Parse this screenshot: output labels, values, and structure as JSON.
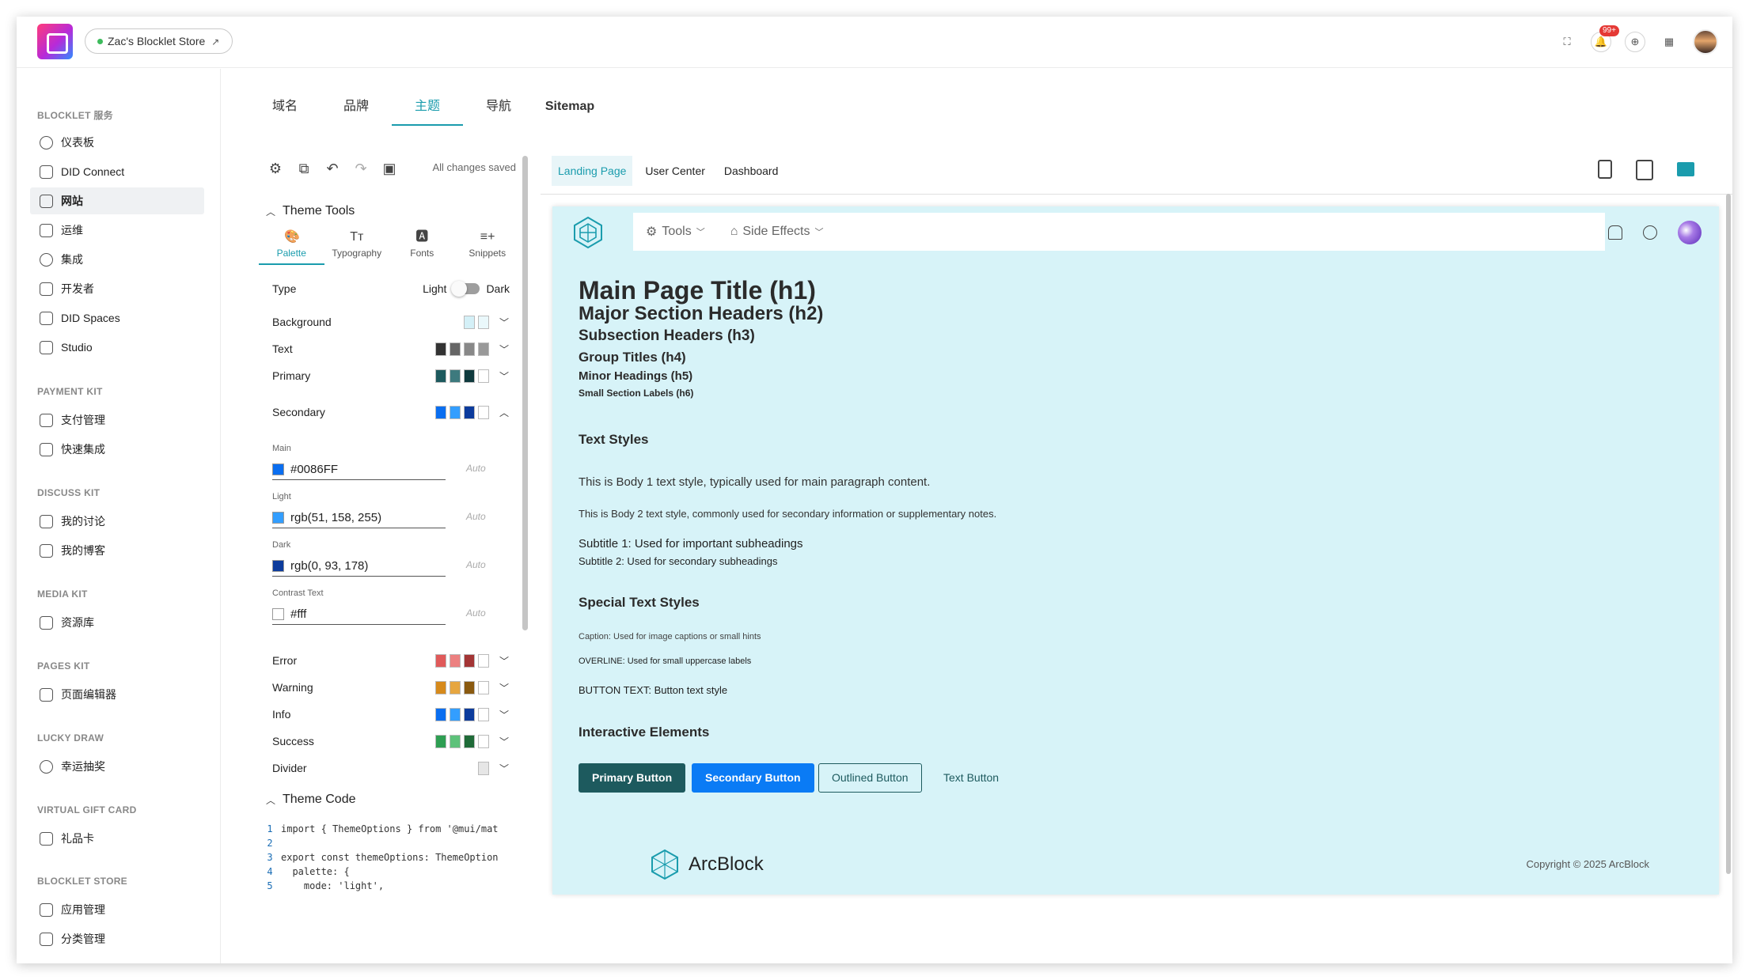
{
  "topbar": {
    "store_name": "Zac's Blocklet Store",
    "store_link_icon": "external-link-icon",
    "notification_count": "99+"
  },
  "sidebar": {
    "sections": [
      {
        "title": "BLOCKLET 服务",
        "items": [
          "仪表板",
          "DID Connect",
          "网站",
          "运维",
          "集成",
          "开发者",
          "DID Spaces",
          "Studio"
        ]
      },
      {
        "title": "PAYMENT KIT",
        "items": [
          "支付管理",
          "快速集成"
        ]
      },
      {
        "title": "DISCUSS KIT",
        "items": [
          "我的讨论",
          "我的博客"
        ]
      },
      {
        "title": "MEDIA KIT",
        "items": [
          "资源库"
        ]
      },
      {
        "title": "PAGES KIT",
        "items": [
          "页面编辑器"
        ]
      },
      {
        "title": "LUCKY DRAW",
        "items": [
          "幸运抽奖"
        ]
      },
      {
        "title": "VIRTUAL GIFT CARD",
        "items": [
          "礼品卡"
        ]
      },
      {
        "title": "BLOCKLET STORE",
        "items": [
          "应用管理",
          "分类管理"
        ]
      }
    ],
    "active_item": "网站"
  },
  "main": {
    "tabs": [
      "域名",
      "品牌",
      "主题",
      "导航",
      "Sitemap"
    ],
    "active_tab": "主题"
  },
  "editor": {
    "status": "All changes saved",
    "theme_tools_title": "Theme Tools",
    "palette_tabs": [
      "Palette",
      "Typography",
      "Fonts",
      "Snippets"
    ],
    "type_label": "Type",
    "type_light": "Light",
    "type_dark": "Dark",
    "rows": {
      "background": "Background",
      "text": "Text",
      "primary": "Primary",
      "secondary": "Secondary",
      "error": "Error",
      "warning": "Warning",
      "info": "Info",
      "success": "Success",
      "divider": "Divider"
    },
    "secondary_fields": [
      {
        "label": "Main",
        "value": "#0086FF",
        "auto": "Auto",
        "color": "#0a6ef0"
      },
      {
        "label": "Light",
        "value": "rgb(51, 158, 255)",
        "auto": "Auto",
        "color": "#339eff"
      },
      {
        "label": "Dark",
        "value": "rgb(0, 93, 178)",
        "auto": "Auto",
        "color": "#0c3b9c"
      },
      {
        "label": "Contrast Text",
        "value": "#fff",
        "auto": "Auto",
        "color": "#ffffff"
      }
    ],
    "theme_code_title": "Theme Code",
    "code_lines": [
      {
        "n": "1",
        "text": "import { ThemeOptions } from '@mui/mat"
      },
      {
        "n": "2",
        "text": ""
      },
      {
        "n": "3",
        "text": "export const themeOptions: ThemeOption"
      },
      {
        "n": "4",
        "text": "  palette: {"
      },
      {
        "n": "5",
        "text": "    mode: 'light',"
      }
    ]
  },
  "preview": {
    "tabs": [
      "Landing Page",
      "User Center",
      "Dashboard"
    ],
    "active_tab": "Landing Page",
    "nav": [
      "Tools",
      "Side Effects"
    ],
    "h1": "Main Page Title (h1)",
    "h2": "Major Section Headers (h2)",
    "h3": "Subsection Headers (h3)",
    "h4": "Group Titles (h4)",
    "h5": "Minor Headings (h5)",
    "h6": "Small Section Labels (h6)",
    "text_styles_title": "Text Styles",
    "body1": "This is Body 1 text style, typically used for main paragraph content.",
    "body2": "This is Body 2 text style, commonly used for secondary information or supplementary notes.",
    "subtitle1": "Subtitle 1: Used for important subheadings",
    "subtitle2": "Subtitle 2: Used for secondary subheadings",
    "special_title": "Special Text Styles",
    "caption": "Caption: Used for image captions or small hints",
    "overline": "OVERLINE: Used for small uppercase labels",
    "button_text": "BUTTON TEXT: Button text style",
    "interactive_title": "Interactive Elements",
    "buttons": [
      "Primary Button",
      "Secondary Button",
      "Outlined Button",
      "Text Button"
    ],
    "brand": "ArcBlock",
    "copyright": "Copyright © 2025 ArcBlock"
  },
  "colors": {
    "accent": "#1a9cad",
    "preview_bg": "#d7f3f8",
    "primary_button": "#1d5a5e",
    "secondary_button": "#0a7bf5"
  }
}
